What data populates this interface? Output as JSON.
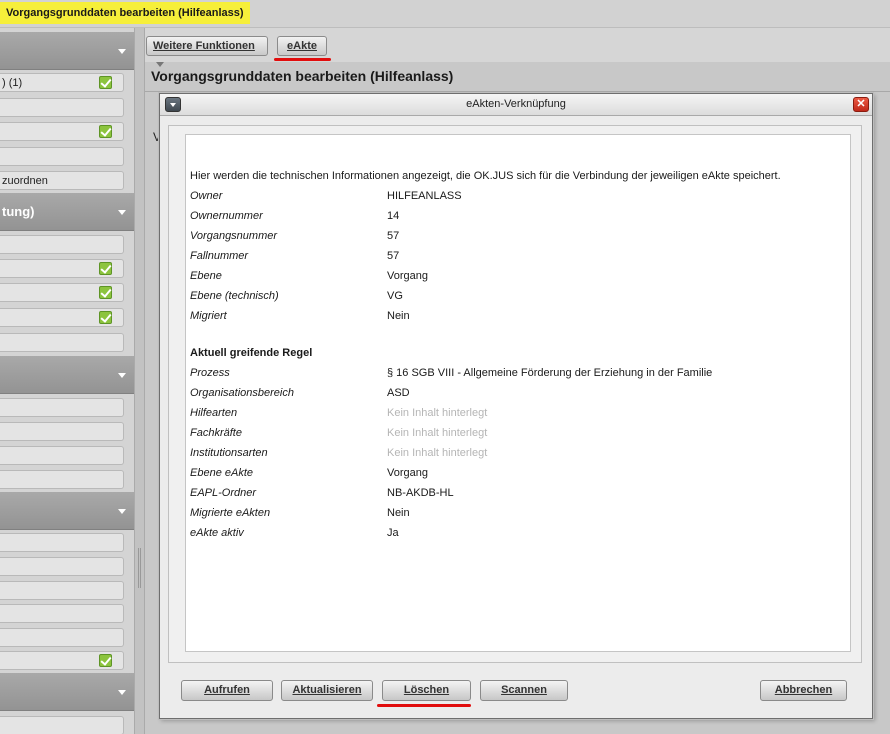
{
  "window": {
    "title": "Vorgangsgrunddaten bearbeiten (Hilfeanlass)"
  },
  "sidebar": {
    "sections": [
      {
        "label": ""
      },
      {
        "label": "tung)"
      },
      {
        "label": ""
      },
      {
        "label": ""
      },
      {
        "label": ""
      }
    ],
    "items": [
      {
        "label": ") (1)",
        "checked": true
      },
      {
        "label": "",
        "checked": false
      },
      {
        "label": "",
        "checked": true
      },
      {
        "label": "",
        "checked": false
      },
      {
        "label": "zuordnen",
        "checked": false
      },
      {
        "label": "",
        "checked": false
      },
      {
        "label": "",
        "checked": true
      },
      {
        "label": "",
        "checked": true
      },
      {
        "label": "",
        "checked": true
      },
      {
        "label": "",
        "checked": false
      },
      {
        "label": "",
        "checked": false
      },
      {
        "label": "",
        "checked": false
      },
      {
        "label": "",
        "checked": false
      },
      {
        "label": "",
        "checked": false
      },
      {
        "label": "",
        "checked": false
      },
      {
        "label": "",
        "checked": false
      },
      {
        "label": "",
        "checked": false
      },
      {
        "label": "",
        "checked": false
      },
      {
        "label": "",
        "checked": false
      },
      {
        "label": "",
        "checked": true
      },
      {
        "label": "",
        "checked": false
      }
    ]
  },
  "toolbar": {
    "more_functions": "Weitere Funktionen",
    "eakte": "eAkte"
  },
  "main": {
    "title": "Vorgangsgrunddaten bearbeiten (Hilfeanlass)",
    "bg_letter": "V"
  },
  "dialog": {
    "title": "eAkten-Verknüpfung",
    "close_glyph": "✕",
    "intro": "Hier werden die technischen Informationen angezeigt, die OK.JUS sich für die Verbindung der jeweiligen eAkte speichert.",
    "rows": [
      {
        "key": "Owner",
        "value": "HILFEANLASS",
        "empty": false
      },
      {
        "key": "Ownernummer",
        "value": "14",
        "empty": false
      },
      {
        "key": "Vorgangsnummer",
        "value": "57",
        "empty": false
      },
      {
        "key": "Fallnummer",
        "value": "57",
        "empty": false
      },
      {
        "key": "Ebene",
        "value": "Vorgang",
        "empty": false
      },
      {
        "key": "Ebene (technisch)",
        "value": "VG",
        "empty": false
      },
      {
        "key": "Migriert",
        "value": "Nein",
        "empty": false
      }
    ],
    "section_title": "Aktuell greifende Regel",
    "rule_rows": [
      {
        "key": "Prozess",
        "value": "§ 16 SGB VIII - Allgemeine Förderung der Erziehung in der Familie",
        "empty": false
      },
      {
        "key": "Organisationsbereich",
        "value": "ASD",
        "empty": false
      },
      {
        "key": "Hilfearten",
        "value": "Kein Inhalt hinterlegt",
        "empty": true
      },
      {
        "key": "Fachkräfte",
        "value": "Kein Inhalt hinterlegt",
        "empty": true
      },
      {
        "key": "Institutionsarten",
        "value": "Kein Inhalt hinterlegt",
        "empty": true
      },
      {
        "key": "Ebene eAkte",
        "value": "Vorgang",
        "empty": false
      },
      {
        "key": "EAPL-Ordner",
        "value": "NB-AKDB-HL",
        "empty": false
      },
      {
        "key": "Migrierte eAkten",
        "value": "Nein",
        "empty": false
      },
      {
        "key": "eAkte aktiv",
        "value": "Ja",
        "empty": false
      }
    ],
    "buttons": {
      "open": "Aufrufen",
      "refresh": "Aktualisieren",
      "delete": "Löschen",
      "scan": "Scannen",
      "cancel": "Abbrechen"
    }
  },
  "colors": {
    "title_highlight": "#f6ef3a",
    "annotation_red": "#e10d0d",
    "check_green": "#8cc43e",
    "close_red": "#c0281a"
  }
}
